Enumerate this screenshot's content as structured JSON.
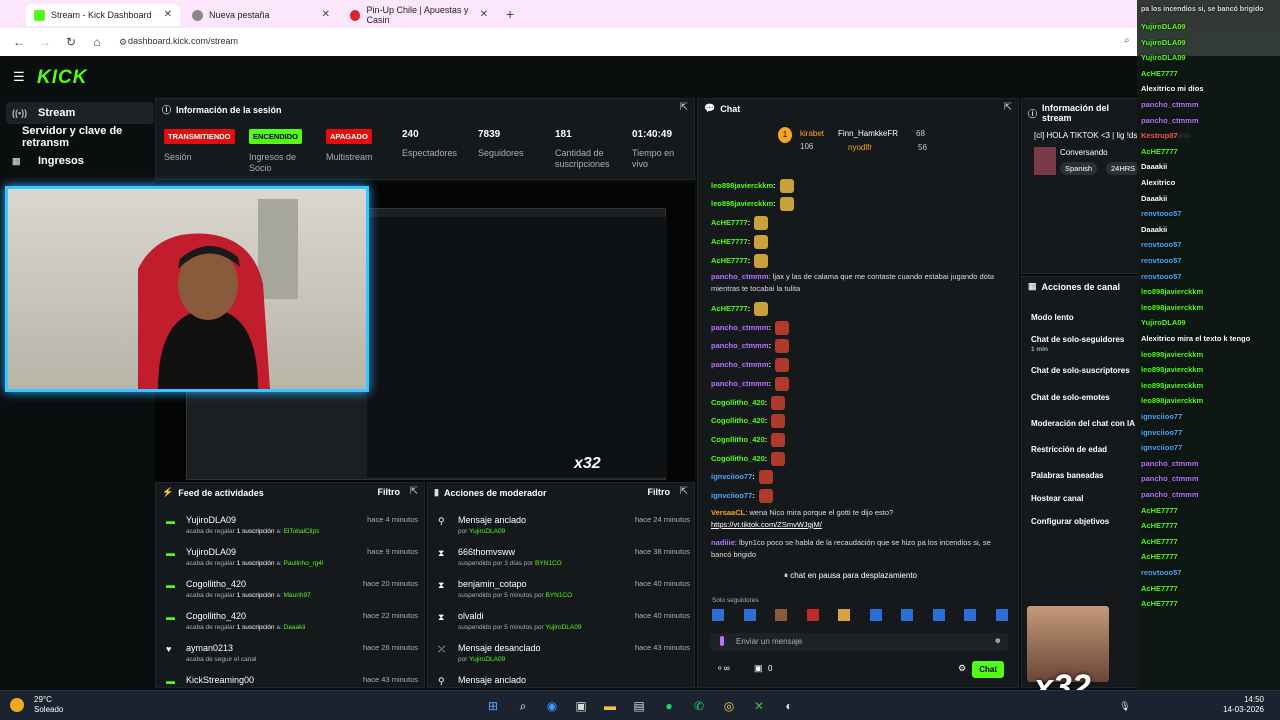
{
  "browser": {
    "tabs": [
      {
        "title": "Stream - Kick Dashboard",
        "color": "#53fc18"
      },
      {
        "title": "Nueva pestaña",
        "color": "#888"
      },
      {
        "title": "Pin-Up Chile | Apuestas y Casin",
        "color": "#d9262c"
      }
    ],
    "url": "dashboard.kick.com/stream"
  },
  "app": {
    "logo": "KICK"
  },
  "sidebar": {
    "items": [
      {
        "label": "Stream",
        "icon": "broadcast-icon"
      },
      {
        "label": "Servidor y clave de retransm",
        "icon": "key-icon"
      },
      {
        "label": "Ingresos",
        "icon": "money-icon"
      }
    ]
  },
  "session": {
    "title": "Información de la sesión",
    "stats": [
      {
        "value": "TRANSMITIENDO",
        "label": "Sesión",
        "kind": "badge-red"
      },
      {
        "value": "ENCENDIDO",
        "label": "Ingresos de Socio",
        "kind": "badge-green"
      },
      {
        "value": "APAGADO",
        "label": "Multistream",
        "kind": "badge-red"
      },
      {
        "value": "240",
        "label": "Espectadores",
        "kind": "num"
      },
      {
        "value": "7839",
        "label": "Seguidores",
        "kind": "num"
      },
      {
        "value": "181",
        "label": "Cantidad de suscripciones",
        "kind": "num"
      },
      {
        "value": "01:40:49",
        "label": "Tiempo en vivo",
        "kind": "num"
      }
    ]
  },
  "feed": {
    "title": "Feed de actividades",
    "filter": "Filtro",
    "rows": [
      {
        "name": "YujiroDLA09",
        "pre": "acaba de regalar ",
        "mid": "1 suscripción",
        "post": " a: ",
        "target": "ElTobalClips",
        "time": "hace 4 minutos"
      },
      {
        "name": "YujiroDLA09",
        "pre": "acaba de regalar ",
        "mid": "1 suscripción",
        "post": " a: ",
        "target": "Paulinho_rg4l",
        "time": "hace 9 minutos"
      },
      {
        "name": "Cogollitho_420",
        "pre": "acaba de regalar ",
        "mid": "1 suscripción",
        "post": " a: ",
        "target": "Maurih97",
        "time": "hace 20 minutos"
      },
      {
        "name": "Cogollitho_420",
        "pre": "acaba de regalar ",
        "mid": "1 suscripción",
        "post": " a: ",
        "target": "Daaakii",
        "time": "hace 22 minutos"
      },
      {
        "name": "ayman0213",
        "pre": "acaba de seguir el canal",
        "mid": "",
        "post": "",
        "target": "",
        "time": "hace 26 minutos"
      },
      {
        "name": "KickStreaming00",
        "pre": "",
        "mid": "",
        "post": "",
        "target": "",
        "time": "hace 43 minutos"
      }
    ]
  },
  "mods": {
    "title": "Acciones de moderador",
    "filter": "Filtro",
    "rows": [
      {
        "name": "Mensaje anclado",
        "sub": "por ",
        "target": "YujiroDLA09",
        "time": "hace 24 minutos",
        "icon": "pin-icon"
      },
      {
        "name": "666thomvsww",
        "sub": "suspendido por 3 días por ",
        "target": "BYN1CO",
        "time": "hace 38 minutos",
        "icon": "hourglass-icon"
      },
      {
        "name": "benjamin_cotapo",
        "sub": "suspendido por 5 minutos por ",
        "target": "BYN1CO",
        "time": "hace 40 minutos",
        "icon": "hourglass-icon"
      },
      {
        "name": "olvaldi",
        "sub": "suspendido por 5 minutos por ",
        "target": "YujiroDLA09",
        "time": "hace 40 minutos",
        "icon": "hourglass-icon"
      },
      {
        "name": "Mensaje desanclado",
        "sub": "por ",
        "target": "YujiroDLA09",
        "time": "hace 43 minutos",
        "icon": "unpin-icon"
      },
      {
        "name": "Mensaje anclado",
        "sub": "",
        "target": "",
        "time": "",
        "icon": "pin-icon"
      }
    ]
  },
  "chat": {
    "title": "Chat",
    "pinned_user": "kirabet",
    "pinned_count": "106",
    "top1": "Finn_HamkkeFR",
    "top1n": "68",
    "top2": "nyodlfr",
    "top2n": "56",
    "lines": [
      {
        "user": "leo898javierckkm",
        "cls": "u",
        "emo": "y"
      },
      {
        "user": "leo898javierckkm",
        "cls": "u",
        "emo": "y"
      },
      {
        "user": "AcHE7777",
        "cls": "u",
        "emo": "y"
      },
      {
        "user": "AcHE7777",
        "cls": "u",
        "emo": "y"
      },
      {
        "user": "AcHE7777",
        "cls": "u",
        "emo": "y"
      }
    ],
    "msg1_user": "pancho_ctmmm",
    "msg1": "ljax y las de calama que me contaste cuando estabai jugando dota mientras te tocabai la tulita",
    "lines2": [
      {
        "user": "AcHE7777",
        "cls": "u",
        "emo": "y"
      },
      {
        "user": "pancho_ctmmm",
        "cls": "p",
        "emo": "r"
      },
      {
        "user": "pancho_ctmmm",
        "cls": "p",
        "emo": "r"
      },
      {
        "user": "pancho_ctmmm",
        "cls": "p",
        "emo": "r"
      },
      {
        "user": "pancho_ctmmm",
        "cls": "p",
        "emo": "r"
      },
      {
        "user": "Cogollitho_420",
        "cls": "u",
        "emo": "r"
      },
      {
        "user": "Cogollitho_420",
        "cls": "u",
        "emo": "r"
      },
      {
        "user": "Cogollitho_420",
        "cls": "u",
        "emo": "r"
      },
      {
        "user": "Cogollitho_420",
        "cls": "u",
        "emo": "r"
      },
      {
        "user": "ignvciioo77",
        "cls": "b",
        "emo": "r"
      },
      {
        "user": "ignvciioo77",
        "cls": "b",
        "emo": "r"
      }
    ],
    "msg2_user": "VersaaCL",
    "msg2": "wena Nico mira porque el gotti te dijo esto?",
    "msg2_link": "https://vt.tiktok.com/ZSmvWJgjM/",
    "msg3_user": "nadiiie",
    "msg3": "lbyn1co poco se habla de la recaudación que se hizo pa los incendios si, se bancó brigido",
    "paused": "chat en pausa para desplazamiento",
    "followers_only": "Solo seguidores",
    "input_placeholder": "Enviar un mensaje",
    "input_count": "0",
    "send_label": "Chat"
  },
  "streaminfo": {
    "title": "Información del stream",
    "stream_title": "[cl] HOLA TIKTOK <3 | lig !ds !voces !casino",
    "category": "Conversando",
    "lang": "Spanish",
    "tag": "24HRS"
  },
  "channelactions": {
    "title": "Acciones de canal",
    "items": [
      "Modo lento",
      "Chat de solo-seguidores",
      "1 min",
      "Chat de solo-suscriptores",
      "Chat de solo-emotes",
      "Moderación del chat con IA",
      "Restricción de edad",
      "Palabras baneadas",
      "Hostear canal",
      "Configurar objetivos"
    ]
  },
  "overlay": {
    "top_text": "pa los incendios si, se bancó brigido",
    "lines": [
      "YujiroDLA09",
      "YujiroDLA09",
      "YujiroDLA09",
      "AcHE7777",
      "Alexitrico mi dios",
      "pancho_ctmmm",
      "pancho_ctmmm",
      "Kestrup87",
      "AcHE7777",
      "Daaakii",
      "Alexitrico",
      "Daaakii",
      "renvtooo57",
      "Daaakii",
      "renvtooo57",
      "renvtooo57",
      "renvtooo57",
      "leo898javierckkm",
      "leo898javierckkm",
      "YujiroDLA09",
      "Alexitrico mira el texto k tengo",
      "leo898javierckkm",
      "leo898javierckkm",
      "leo898javierckkm",
      "leo898javierckkm",
      "ignvciioo77",
      "ignvciioo77",
      "ignvciioo77",
      "pancho_ctmmm",
      "pancho_ctmmm",
      "pancho_ctmmm",
      "AcHE7777",
      "AcHE7777",
      "AcHE7777",
      "AcHE7777",
      "renvtooo57",
      "AcHE7777",
      "AcHE7777"
    ]
  },
  "overlay_badge": "x32",
  "taskbar": {
    "temp": "29°C",
    "weather": "Soleado",
    "time": "14:50",
    "date": "14-03-2026"
  }
}
